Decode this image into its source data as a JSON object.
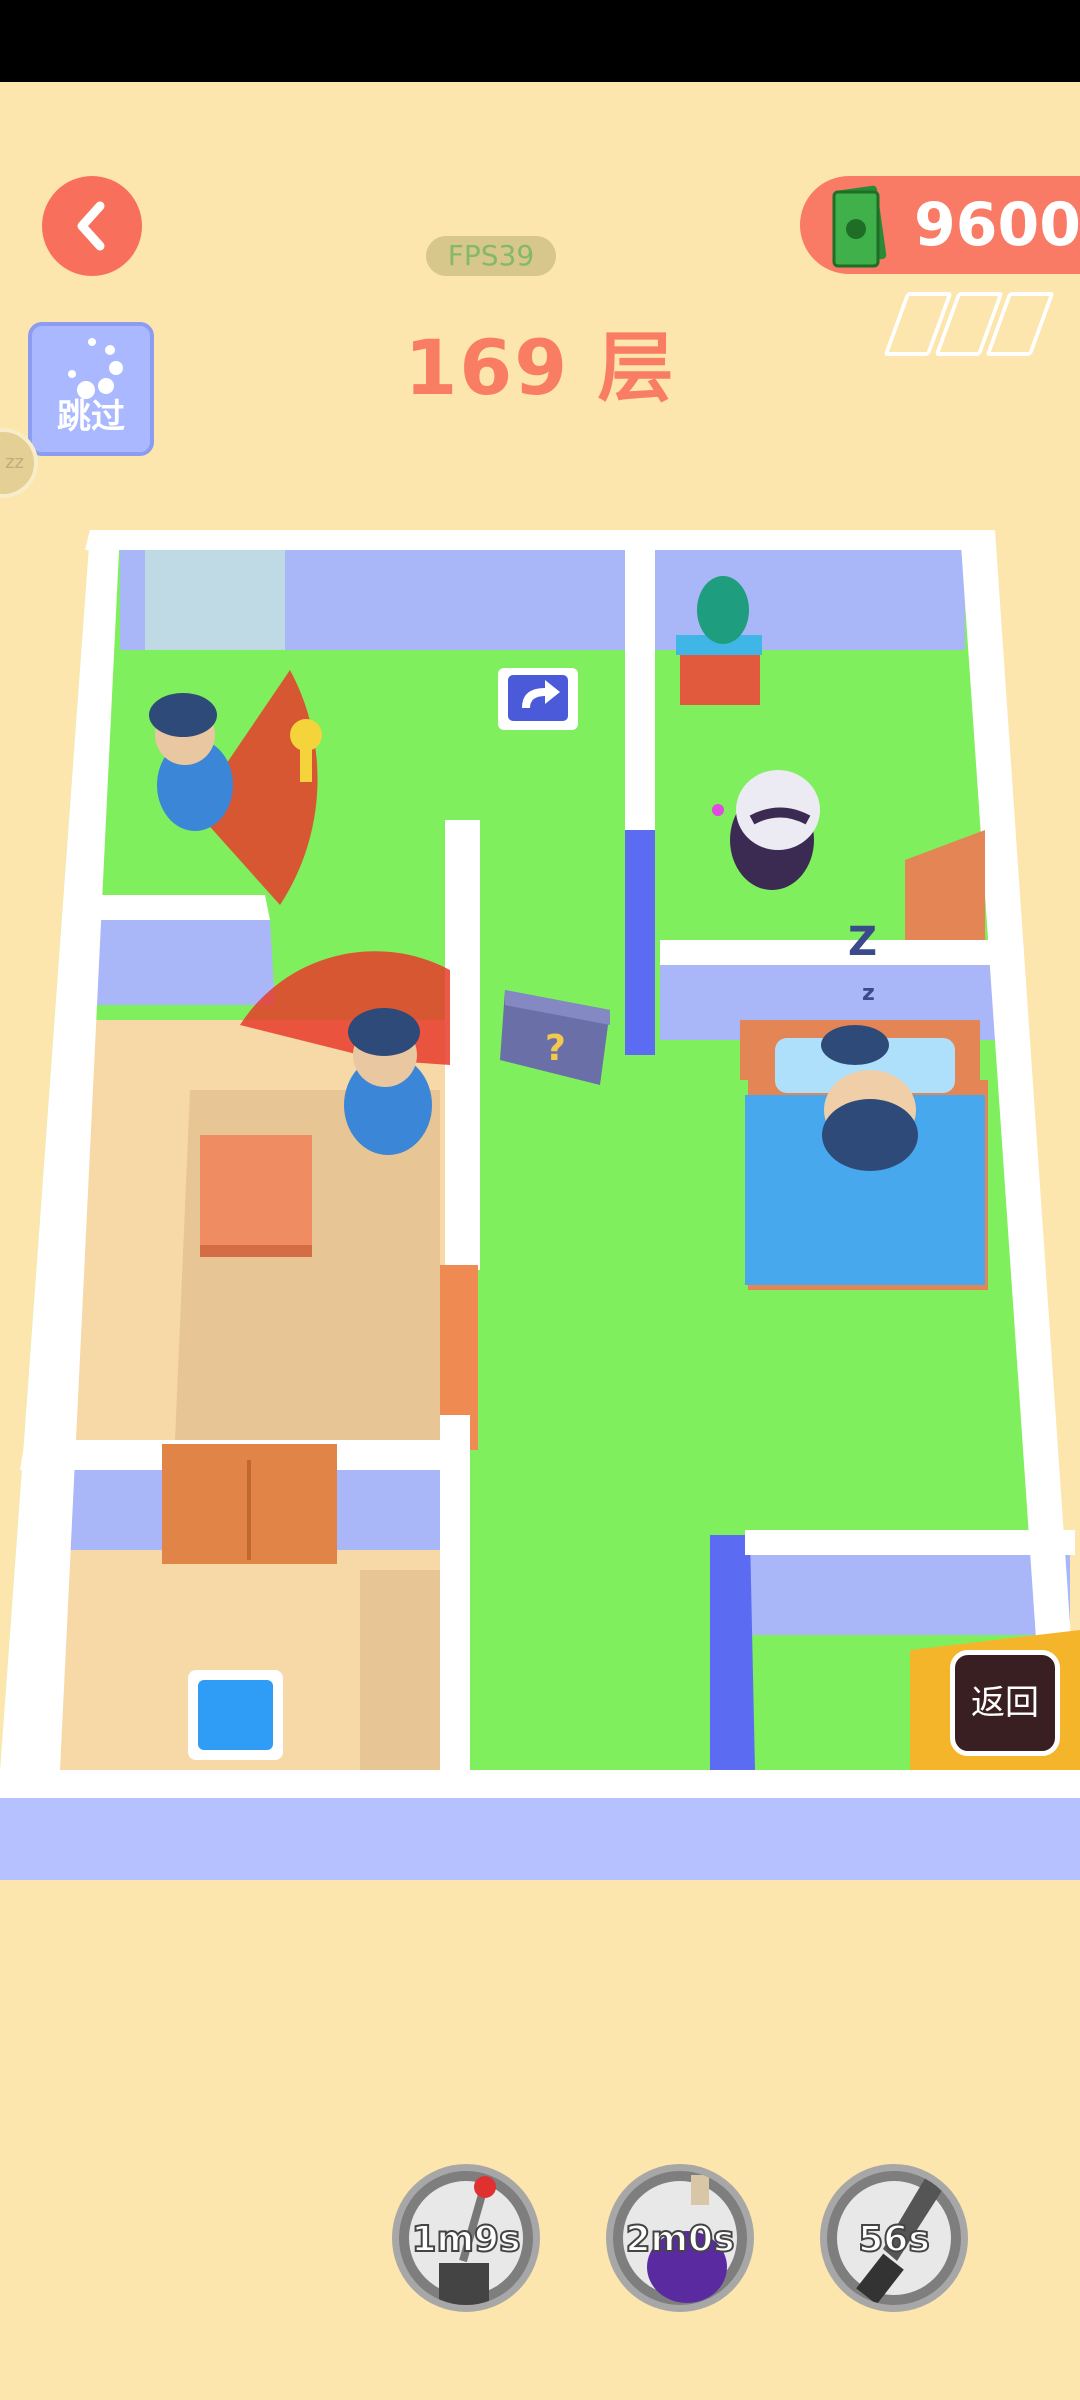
{
  "status_bar": {},
  "header": {
    "fps_label": "FPS39",
    "level_text": "169 层",
    "skip_label": "跳过",
    "side_badge": "zz",
    "money": "9600"
  },
  "scene": {
    "sleep_mark": "z",
    "return_label": "返回"
  },
  "powerups": [
    {
      "name": "lever",
      "time": "1m9s"
    },
    {
      "name": "potion",
      "time": "2m0s"
    },
    {
      "name": "knife",
      "time": "56s"
    }
  ],
  "colors": {
    "background": "#fde6ad",
    "accent": "#f86f5c",
    "floor_green": "#7ff05e",
    "wall_blue": "#a9b6f7",
    "floor_tan": "#f7d9a8",
    "vision_red": "#e83c2c"
  }
}
